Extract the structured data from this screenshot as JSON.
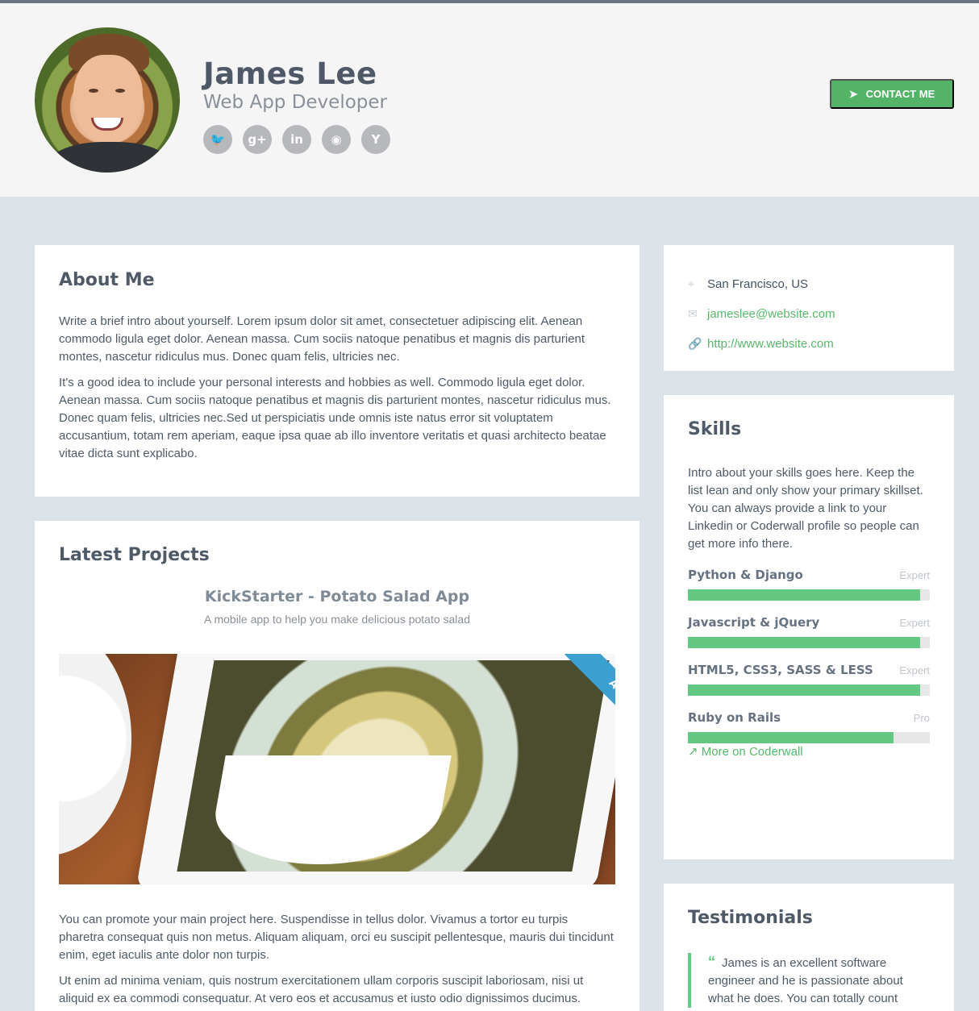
{
  "header": {
    "name": "James Lee",
    "title": "Web App Developer",
    "socials": [
      {
        "name": "twitter-icon",
        "glyph": "🐦"
      },
      {
        "name": "google-plus-icon",
        "glyph": "g+"
      },
      {
        "name": "linkedin-icon",
        "glyph": "in"
      },
      {
        "name": "github-icon",
        "glyph": "◉"
      },
      {
        "name": "hacker-news-icon",
        "glyph": "Y"
      }
    ],
    "contact_label": "CONTACT ME"
  },
  "about": {
    "heading": "About Me",
    "paragraphs": [
      "Write a brief intro about yourself. Lorem ipsum dolor sit amet, consectetuer adipiscing elit. Aenean commodo ligula eget dolor. Aenean massa. Cum sociis natoque penatibus et magnis dis parturient montes, nascetur ridiculus mus. Donec quam felis, ultricies nec.",
      "It's a good idea to include your personal interests and hobbies as well. Commodo ligula eget dolor. Aenean massa. Cum sociis natoque penatibus et magnis dis parturient montes, nascetur ridiculus mus. Donec quam felis, ultricies nec.Sed ut perspiciatis unde omnis iste natus error sit voluptatem accusantium, totam rem aperiam, eaque ipsa quae ab illo inventore veritatis et quasi architecto beatae vitae dicta sunt explicabo."
    ]
  },
  "projects": {
    "heading": "Latest Projects",
    "project_title": "KickStarter - Potato Salad App",
    "project_description": "A mobile app to help you make delicious potato salad",
    "ribbon_label": "APP",
    "paragraphs": [
      "You can promote your main project here. Suspendisse in tellus dolor. Vivamus a tortor eu turpis pharetra consequat quis non metus. Aliquam aliquam, orci eu suscipit pellentesque, mauris dui tincidunt enim, eget iaculis ante dolor non turpis.",
      "Ut enim ad minima veniam, quis nostrum exercitationem ullam corporis suscipit laboriosam, nisi ut aliquid ex ea commodi consequatur. At vero eos et accusamus et iusto odio dignissimos ducimus."
    ]
  },
  "info": {
    "location": "San Francisco, US",
    "email": "jameslee@website.com",
    "website": "http://www.website.com"
  },
  "skills": {
    "heading": "Skills",
    "intro": "Intro about your skills goes here. Keep the list lean and only show your primary skillset. You can always provide a link to your Linkedin or Coderwall profile so people can get more info there.",
    "items": [
      {
        "name": "Python & Django",
        "level": "Expert",
        "value": 96
      },
      {
        "name": "Javascript & jQuery",
        "level": "Expert",
        "value": 96
      },
      {
        "name": "HTML5, CSS3, SASS & LESS",
        "level": "Expert",
        "value": 96
      },
      {
        "name": "Ruby on Rails",
        "level": "Pro",
        "value": 85
      }
    ],
    "more_label": "More on Coderwall"
  },
  "testimonials": {
    "heading": "Testimonials",
    "quote": "James is an excellent software engineer and he is passionate about what he does. You can totally count"
  },
  "colors": {
    "accent": "#58b86a",
    "bar_fill": "#65c882",
    "ribbon": "#3b9fd1",
    "background": "#dbe3e9"
  }
}
